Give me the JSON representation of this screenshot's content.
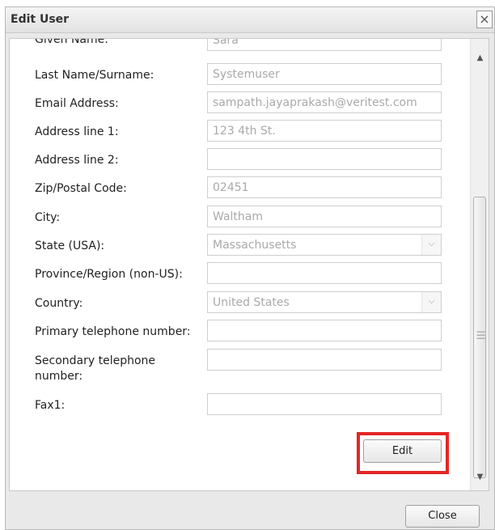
{
  "window": {
    "title": "Edit User",
    "close_x": "×"
  },
  "form": {
    "fields": [
      {
        "label": "Given Name:",
        "value": "Sara"
      },
      {
        "label": "Last Name/Surname:",
        "value": "Systemuser"
      },
      {
        "label": "Email Address:",
        "value": "sampath.jayaprakash@veritest.com"
      },
      {
        "label": "Address line 1:",
        "value": "123 4th St."
      },
      {
        "label": "Address line 2:",
        "value": ""
      },
      {
        "label": "Zip/Postal Code:",
        "value": "02451"
      },
      {
        "label": "City:",
        "value": "Waltham"
      },
      {
        "label": "State (USA):",
        "value": "Massachusetts"
      },
      {
        "label": "Province/Region (non-US):",
        "value": ""
      },
      {
        "label": "Country:",
        "value": "United States"
      },
      {
        "label": "Primary telephone number:",
        "value": ""
      },
      {
        "label": "Secondary telephone number:",
        "value": ""
      },
      {
        "label": "Fax1:",
        "value": ""
      }
    ],
    "edit_label": "Edit"
  },
  "footer": {
    "close_label": "Close"
  },
  "colors": {
    "highlight": "#e32626"
  }
}
